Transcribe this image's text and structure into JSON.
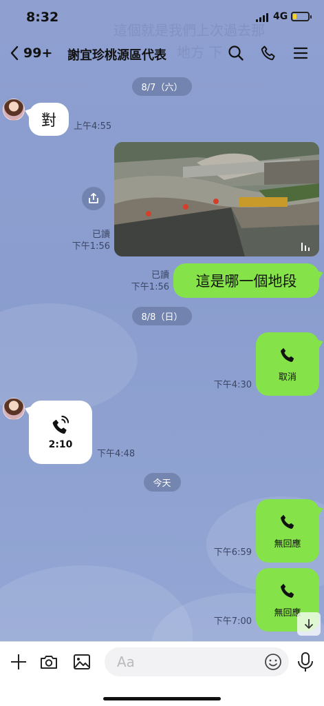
{
  "status_bar": {
    "time": "8:32",
    "network": "4G",
    "battery_level": 0.2
  },
  "header": {
    "unread_count": "99+",
    "chat_name": "謝宜珍桃源區代表",
    "ghost_text": [
      "這個就是我們上次過去那",
      "地方 下"
    ]
  },
  "messages": {
    "date1": "8/7（六）",
    "m1": {
      "text": "對",
      "time": "上午4:55"
    },
    "m2": {
      "read": "已讀",
      "time": "下午1:56"
    },
    "m3": {
      "text": "這是哪一個地段",
      "read": "已讀",
      "time": "下午1:56"
    },
    "date2": "8/8（日）",
    "m4": {
      "label": "取消",
      "time": "下午4:30"
    },
    "m5": {
      "duration": "2:10",
      "time": "下午4:48"
    },
    "date3": "今天",
    "m6": {
      "label": "無回應",
      "time": "下午6:59"
    },
    "m7": {
      "label": "無回應",
      "time": "下午7:00"
    }
  },
  "input": {
    "placeholder": "Aa"
  },
  "colors": {
    "outgoing": "#85e249",
    "incoming": "#ffffff",
    "background": "#8ea0cf"
  }
}
